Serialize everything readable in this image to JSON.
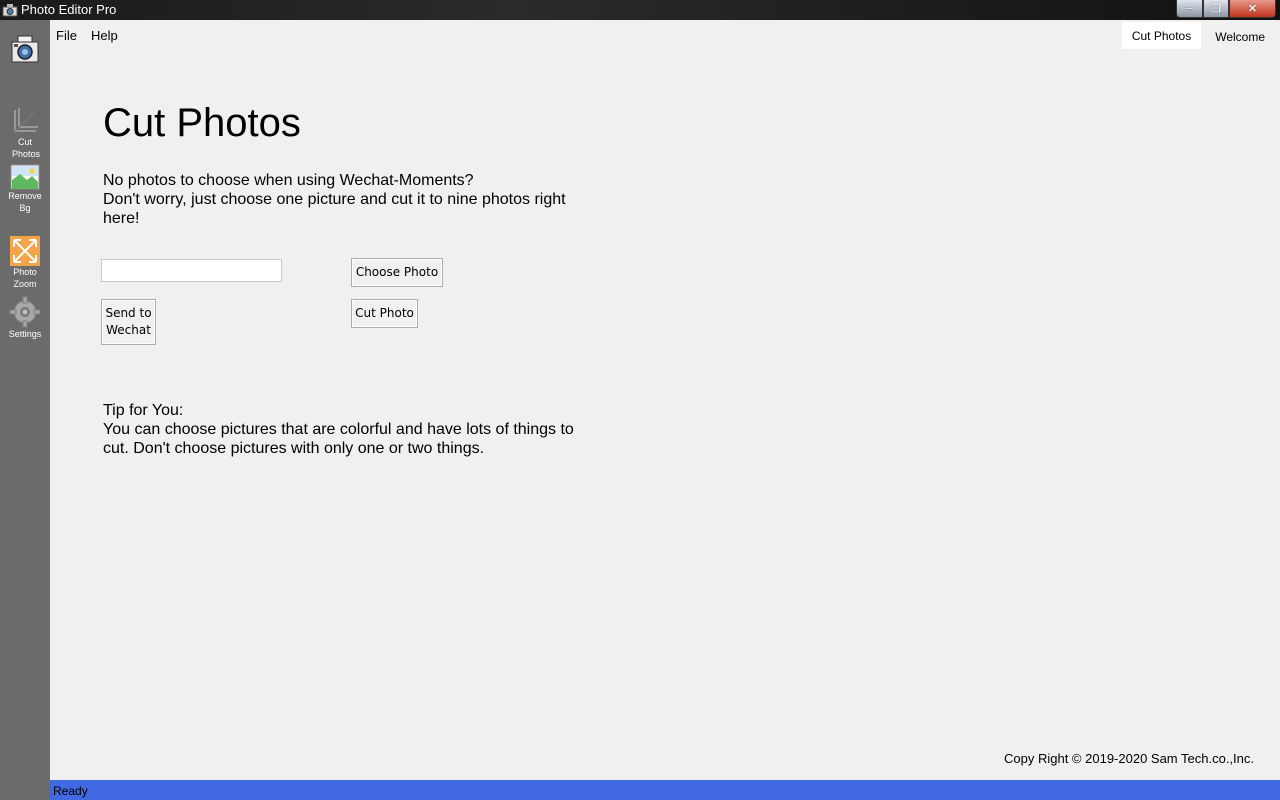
{
  "window": {
    "title": "Photo Editor Pro",
    "buttons": {
      "minimize": "minimize",
      "maximize": "maximize",
      "close": "close"
    }
  },
  "sidebar": {
    "items": [
      {
        "id": "home",
        "label": "",
        "icon": "camera-icon"
      },
      {
        "id": "cut-photos",
        "label": "Cut Photos",
        "icon": "crop-icon"
      },
      {
        "id": "remove-bg",
        "label": "Remove Bg",
        "icon": "landscape-icon"
      },
      {
        "id": "photo-zoom",
        "label": "Photo Zoom",
        "icon": "expand-arrows-icon"
      },
      {
        "id": "settings",
        "label": "Settings",
        "icon": "gear-icon"
      }
    ]
  },
  "menu": {
    "file": "File",
    "help": "Help"
  },
  "tabs": [
    {
      "label": "Cut Photos",
      "active": true
    },
    {
      "label": "Welcome",
      "active": false
    }
  ],
  "main": {
    "title": "Cut Photos",
    "desc_line1": "No photos to choose when using Wechat-Moments?",
    "desc_line2": "Don't worry, just choose one picture and cut it to nine photos right here!",
    "path_input": {
      "value": "",
      "placeholder": ""
    },
    "choose_photo": "Choose Photo",
    "cut_photo": "Cut Photo",
    "send_line1": "Send to",
    "send_line2": "Wechat",
    "tip_title": "Tip for You:",
    "tip_body": "You can choose pictures that are colorful and have lots of things to cut. Don't choose pictures with only one or two things."
  },
  "footer": {
    "copyright": "Copy Right © 2019-2020 Sam Tech.co.,Inc."
  },
  "status": {
    "text": "Ready"
  },
  "colors": {
    "status_bar": "#4169e1",
    "sidebar": "#6b6b6b",
    "background": "#f0f0f0"
  }
}
